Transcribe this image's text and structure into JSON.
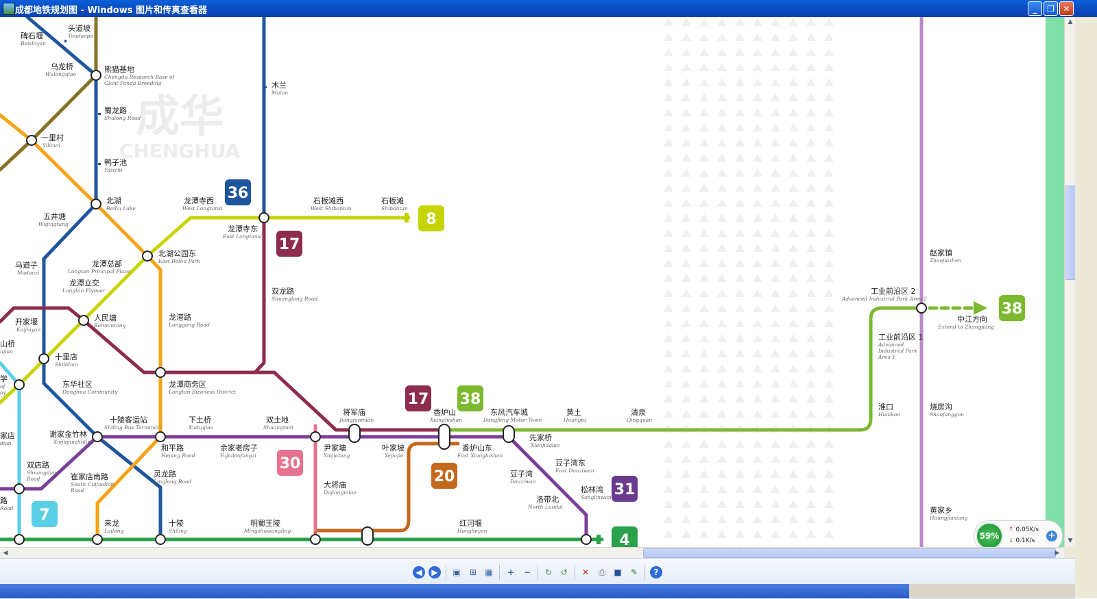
{
  "window": {
    "title": "成都地铁规划图 - Windows 图片和传真查看器",
    "buttons": {
      "minimize": "_",
      "restore": "❐",
      "close": "✕"
    }
  },
  "map": {
    "watermark": {
      "cn": "成华",
      "en": "CHENGHUA"
    },
    "line_colors": {
      "3": "#e7006f",
      "4": "#2aa14b",
      "7": "#5bcfe5",
      "8": "#c8d400",
      "17": "#8d2c4f",
      "20": "#c4681d",
      "30": "#e5728e",
      "31": "#6a3a8e",
      "36": "#1f559d",
      "38": "#7cb92f",
      "line_gold": "#8a7024",
      "line_orange": "#f5a315",
      "line_lilac": "#b98ac7"
    },
    "badges": {
      "b36": "36",
      "b8": "8",
      "b17a": "17",
      "b17b": "17",
      "b38a": "38",
      "b38b": "38",
      "b30": "30",
      "b20": "20",
      "b31": "31",
      "b7": "7",
      "b4": "4"
    },
    "stations": {
      "beishiyan": {
        "cn": "碑石堰",
        "en": "Beishiyan"
      },
      "toudaopo": {
        "cn": "头道坡",
        "en": "Toudaopo"
      },
      "wulongqiao": {
        "cn": "乌龙桥",
        "en": "Wulongqiao"
      },
      "panda_cn": "熊猫基地",
      "panda_en1": "Chengdu Research Base of",
      "panda_en2": "Giant Panda Breeding",
      "mulan": {
        "cn": "木兰",
        "en": "Mulan"
      },
      "shulonglu": {
        "cn": "蜀龙路",
        "en": "Shulong Road"
      },
      "yilicun": {
        "cn": "一里村",
        "en": "Yilicun"
      },
      "yazichi": {
        "cn": "鸭子池",
        "en": "Yazichi"
      },
      "beihu": {
        "cn": "北湖",
        "en": "Beihu Lake"
      },
      "longtansixi": {
        "cn": "龙潭寺西",
        "en": "West Longtansi"
      },
      "longtansidong": {
        "cn": "龙潭寺东",
        "en": "East Longtansi"
      },
      "shibantanxi": {
        "cn": "石板滩西",
        "en": "West Shibantan"
      },
      "shibantan": {
        "cn": "石板滩",
        "en": "Shibantan"
      },
      "wujingtang": {
        "cn": "五井塘",
        "en": "Wujingtang"
      },
      "beihugongyuandong": {
        "cn": "北湖公园东",
        "en": "East Beihu Park"
      },
      "madaozi": {
        "cn": "马道子",
        "en": "Madaozi"
      },
      "longtanzongbu": {
        "cn": "龙潭总部",
        "en": "Longtan Principal Place"
      },
      "longtanlijiao": {
        "cn": "龙潭立交",
        "en": "Longtan Flyover"
      },
      "shuanglonglu": {
        "cn": "双龙路",
        "en": "Shuanglong Road"
      },
      "renmintang": {
        "cn": "人民塘",
        "en": "Renmintang"
      },
      "kaijiayan": {
        "cn": "开家堰",
        "en": "Kaijiayan"
      },
      "longganglu": {
        "cn": "龙港路",
        "en": "Longgang Road"
      },
      "shanqiao": {
        "cn": "山桥",
        "en": "iqiao"
      },
      "shilidian": {
        "cn": "十里店",
        "en": "Shilidian"
      },
      "xue": {
        "cn": "学",
        "en": "of"
      },
      "xue2": {
        "en": "ay"
      },
      "donghuashequ": {
        "cn": "东华社区",
        "en": "Donghua Community"
      },
      "longtanshangwuqu": {
        "cn": "龙潭商务区",
        "en": "Longtan Business District"
      },
      "shilingkeyunzhan": {
        "cn": "十陵客运站",
        "en": "Shiling Bus Terminal"
      },
      "xiatuqiao": {
        "cn": "下土桥",
        "en": "Xiatuqiao"
      },
      "shuangtudi": {
        "cn": "双土地",
        "en": "Shuangtudi"
      },
      "jiangjunmiao": {
        "cn": "将军庙",
        "en": "Jiangjunmiao"
      },
      "xianglushan": {
        "cn": "香炉山",
        "en": "Xianglushan"
      },
      "dongfengqiche": {
        "cn": "东风汽车城",
        "en": "Dongfeng Motor Town"
      },
      "huangtu": {
        "cn": "黄土",
        "en": "Huangtu"
      },
      "qingquan": {
        "cn": "清泉",
        "en": "Qingquan"
      },
      "jiadian": {
        "cn": "家店",
        "en": "dian"
      },
      "xiejiajinzhulin": {
        "cn": "谢家金竹林",
        "en": "Xiejiajinzhulin"
      },
      "hepinglu": {
        "cn": "和平路",
        "en": "Heping Road"
      },
      "yujialaofangzi": {
        "cn": "余家老房子",
        "en": "Yujialaofangzi"
      },
      "yinjiatang": {
        "cn": "尹家塘",
        "en": "Yinjiatang"
      },
      "yejiapo": {
        "cn": "叶家坡",
        "en": "Yejiapo"
      },
      "xianglushandong": {
        "cn": "香炉山东",
        "en": "East Xianglushan"
      },
      "xianjiaqiao": {
        "cn": "先家桥",
        "en": "Xianjiaqiao"
      },
      "shuangdianlu_cn": "双店路",
      "shuangdianlu_en1": "Shuangdian",
      "shuangdianlu_en2": "Road",
      "cuijiadiannanlu_cn": "崔家店南路",
      "cuijiadiannanlu_en1": "South Cuijiadian",
      "cuijiadiannanlu_en2": "Road",
      "linglonglu": {
        "cn": "灵龙路",
        "en": "Linglong Road"
      },
      "dajiangmiao": {
        "cn": "大将庙",
        "en": "Dajiangmiao"
      },
      "douziwan": {
        "cn": "豆子湾",
        "en": "Douziwan"
      },
      "douziwandong": {
        "cn": "豆子湾东",
        "en": "East Douziwan"
      },
      "luodaibei": {
        "cn": "洛带北",
        "en": "North Luodai"
      },
      "songlinwan": {
        "cn": "松林湾",
        "en": "Songlinwan"
      },
      "lu": {
        "cn": "路",
        "en": "Road"
      },
      "lailong": {
        "cn": "来龙",
        "en": "Lailong"
      },
      "shiling": {
        "cn": "十陵",
        "en": "Shiling"
      },
      "mingshuwangling": {
        "cn": "明蜀王陵",
        "en": "Mingshuwangling"
      },
      "hongheyan": {
        "cn": "红河堰",
        "en": "Hongheyan"
      },
      "zhaojiazhen": {
        "cn": "赵家镇",
        "en": "Zhaojiazhen"
      },
      "gongye2_cn": "工业前沿区 2",
      "gongye2_en": "Advanced Industrial Park Area 2",
      "zhongjiang": {
        "cn": "中江方向",
        "en": "Extend to Zhongjiang"
      },
      "gongye1_cn": "工业前沿区 1",
      "gongye1_en1": "Advanced",
      "gongye1_en2": "Industrial Park",
      "gongye1_en3": "Area 1",
      "huaikou": {
        "cn": "淮口",
        "en": "Huaikou"
      },
      "shaofanggou": {
        "cn": "烧房沟",
        "en": "Shaofanggou"
      },
      "huangjiaxiang": {
        "cn": "黄家乡",
        "en": "Huangjiaxiang"
      }
    }
  },
  "netmonitor": {
    "percent": "59%",
    "up": "0.05K/s",
    "down": "0.1K/s"
  },
  "toolbar": {
    "icons": [
      "prev-image-icon",
      "next-image-icon",
      "best-fit-icon",
      "actual-size-icon",
      "slideshow-icon",
      "zoom-in-icon",
      "zoom-out-icon",
      "rotate-clockwise-icon",
      "rotate-counterclockwise-icon",
      "delete-icon",
      "print-icon",
      "save-icon",
      "edit-icon",
      "help-icon"
    ],
    "glyphs": {
      "prev": "◀",
      "next": "▶",
      "bestfit": "▣",
      "actual": "⊞",
      "slideshow": "▦",
      "zoomin": "+",
      "zoomout": "−",
      "rotcw": "↻",
      "rotccw": "↺",
      "delete": "✕",
      "print": "⎙",
      "save": "■",
      "edit": "✎",
      "help": "?"
    }
  }
}
